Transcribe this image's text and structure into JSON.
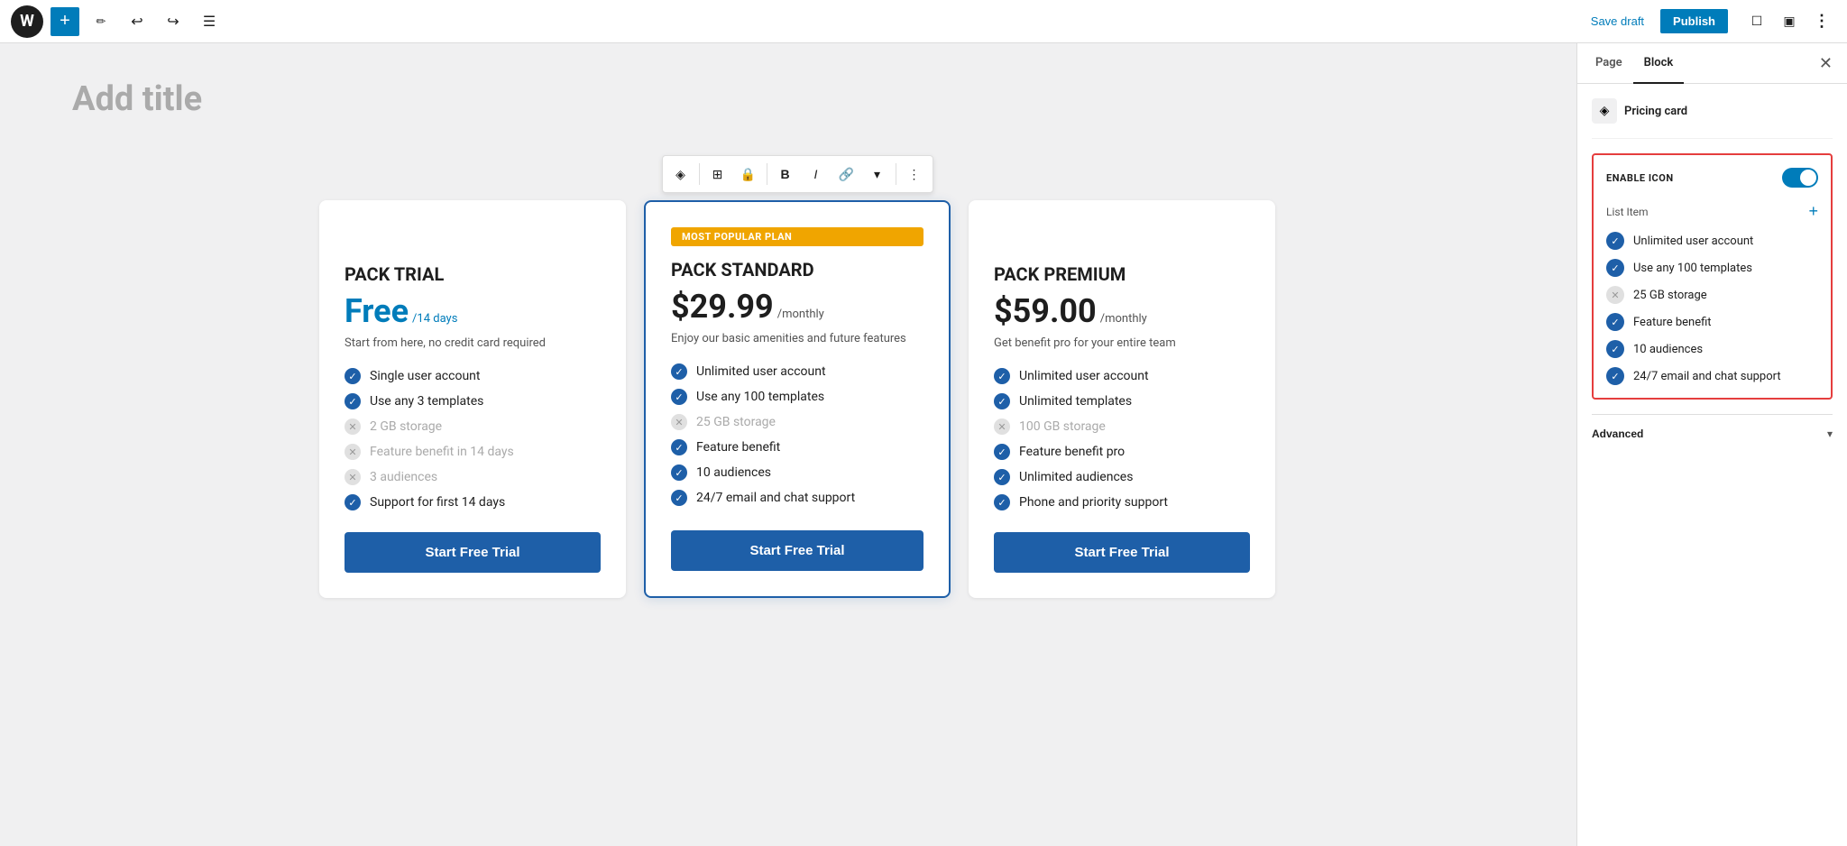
{
  "topbar": {
    "wp_logo": "W",
    "add_icon": "+",
    "edit_icon": "✏",
    "undo_icon": "↩",
    "redo_icon": "↪",
    "list_icon": "☰",
    "save_draft_label": "Save draft",
    "publish_label": "Publish",
    "view_icon": "⬜",
    "layout_icon": "⬜",
    "more_icon": "⋮"
  },
  "editor": {
    "page_title_placeholder": "Add title",
    "toolbar_buttons": [
      {
        "icon": "◈",
        "label": "transform"
      },
      {
        "icon": "⊞",
        "label": "drag-handle"
      },
      {
        "icon": "🔒",
        "label": "lock"
      },
      {
        "icon": "B",
        "label": "bold"
      },
      {
        "icon": "I",
        "label": "italic"
      },
      {
        "icon": "🔗",
        "label": "link"
      },
      {
        "icon": "▾",
        "label": "more-rich"
      },
      {
        "icon": "⋮",
        "label": "options"
      }
    ]
  },
  "pricing_cards": [
    {
      "id": "trial",
      "featured": false,
      "badge": null,
      "title": "PACK TRIAL",
      "price_main": "Free",
      "price_period": "/14 days",
      "price_color": "blue",
      "description": "Start from here, no credit card required",
      "features": [
        {
          "text": "Single user account",
          "enabled": true
        },
        {
          "text": "Use any 3 templates",
          "enabled": true
        },
        {
          "text": "2 GB storage",
          "enabled": false
        },
        {
          "text": "Feature benefit in 14 days",
          "enabled": false
        },
        {
          "text": "3 audiences",
          "enabled": false
        },
        {
          "text": "Support for first 14 days",
          "enabled": true
        }
      ],
      "cta_label": "Start Free Trial"
    },
    {
      "id": "standard",
      "featured": true,
      "badge": "MOST POPULAR PLAN",
      "title": "PACK STANDARD",
      "price_main": "$29.99",
      "price_period": "/monthly",
      "price_color": "dark",
      "description": "Enjoy our basic amenities and future features",
      "features": [
        {
          "text": "Unlimited user account",
          "enabled": true
        },
        {
          "text": "Use any 100 templates",
          "enabled": true
        },
        {
          "text": "25 GB storage",
          "enabled": false
        },
        {
          "text": "Feature benefit",
          "enabled": true
        },
        {
          "text": "10 audiences",
          "enabled": true
        },
        {
          "text": "24/7 email and chat support",
          "enabled": true
        }
      ],
      "cta_label": "Start Free Trial"
    },
    {
      "id": "premium",
      "featured": false,
      "badge": null,
      "title": "PACK PREMIUM",
      "price_main": "$59.00",
      "price_period": "/monthly",
      "price_color": "dark",
      "description": "Get benefit pro for your entire team",
      "features": [
        {
          "text": "Unlimited user account",
          "enabled": true
        },
        {
          "text": "Unlimited templates",
          "enabled": true
        },
        {
          "text": "100 GB storage",
          "enabled": false
        },
        {
          "text": "Feature benefit pro",
          "enabled": true
        },
        {
          "text": "Unlimited audiences",
          "enabled": true
        },
        {
          "text": "Phone and priority support",
          "enabled": true
        }
      ],
      "cta_label": "Start Free Trial"
    }
  ],
  "sidebar": {
    "tabs": [
      {
        "label": "Page",
        "active": false
      },
      {
        "label": "Block",
        "active": true
      }
    ],
    "close_icon": "✕",
    "block_icon": "◈",
    "block_name": "Pricing card",
    "enable_icon_label": "ENABLE ICON",
    "toggle_on": true,
    "list_item_label": "List Item",
    "add_item_icon": "+",
    "features": [
      {
        "text": "Unlimited user account",
        "enabled": true
      },
      {
        "text": "Use any 100 templates",
        "enabled": true
      },
      {
        "text": "25 GB storage",
        "enabled": false
      },
      {
        "text": "Feature benefit",
        "enabled": true
      },
      {
        "text": "10 audiences",
        "enabled": true
      },
      {
        "text": "24/7 email and chat support",
        "enabled": true
      }
    ],
    "advanced_label": "Advanced",
    "advanced_chevron": "▾"
  }
}
